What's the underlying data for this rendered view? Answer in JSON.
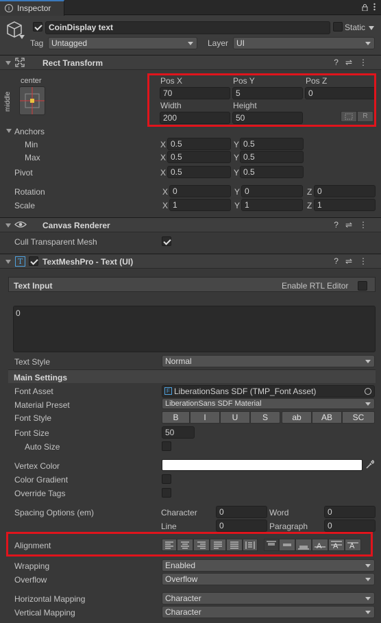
{
  "tab": {
    "title": "Inspector"
  },
  "object": {
    "enabled": true,
    "name": "CoinDisplay text",
    "static_label": "Static",
    "tag_label": "Tag",
    "tag_value": "Untagged",
    "layer_label": "Layer",
    "layer_value": "UI"
  },
  "rect_transform": {
    "title": "Rect Transform",
    "anchor_h": "center",
    "anchor_v": "middle",
    "pos_x_label": "Pos X",
    "pos_y_label": "Pos Y",
    "pos_z_label": "Pos Z",
    "pos_x": "70",
    "pos_y": "5",
    "pos_z": "0",
    "width_label": "Width",
    "height_label": "Height",
    "width": "200",
    "height": "50",
    "r_button": "R",
    "anchors_label": "Anchors",
    "min_label": "Min",
    "max_label": "Max",
    "anchor_min_x": "0.5",
    "anchor_min_y": "0.5",
    "anchor_max_x": "0.5",
    "anchor_max_y": "0.5",
    "pivot_label": "Pivot",
    "pivot_x": "0.5",
    "pivot_y": "0.5",
    "rotation_label": "Rotation",
    "rot_x": "0",
    "rot_y": "0",
    "rot_z": "0",
    "scale_label": "Scale",
    "scale_x": "1",
    "scale_y": "1",
    "scale_z": "1",
    "x": "X",
    "y": "Y",
    "z": "Z"
  },
  "canvas_renderer": {
    "title": "Canvas Renderer",
    "cull_label": "Cull Transparent Mesh",
    "cull_value": true
  },
  "tmp": {
    "title": "TextMeshPro - Text (UI)",
    "text_input_label": "Text Input",
    "rtl_label": "Enable RTL Editor",
    "text_value": "0",
    "text_style_label": "Text Style",
    "text_style_value": "Normal",
    "main_settings_label": "Main Settings",
    "font_asset_label": "Font Asset",
    "font_asset_value": "LiberationSans SDF (TMP_Font Asset)",
    "material_preset_label": "Material Preset",
    "material_preset_value": "LiberationSans SDF Material",
    "font_style_label": "Font Style",
    "font_style_buttons": [
      "B",
      "I",
      "U",
      "S",
      "ab",
      "AB",
      "SC"
    ],
    "font_size_label": "Font Size",
    "font_size_value": "50",
    "auto_size_label": "Auto Size",
    "vertex_color_label": "Vertex Color",
    "vertex_color": "#ffffff",
    "color_gradient_label": "Color Gradient",
    "override_tags_label": "Override Tags",
    "spacing_label": "Spacing Options (em)",
    "character_label": "Character",
    "character_value": "0",
    "word_label": "Word",
    "word_value": "0",
    "line_label": "Line",
    "line_value": "0",
    "paragraph_label": "Paragraph",
    "paragraph_value": "0",
    "alignment_label": "Alignment",
    "wrapping_label": "Wrapping",
    "wrapping_value": "Enabled",
    "overflow_label": "Overflow",
    "overflow_value": "Overflow",
    "hmap_label": "Horizontal Mapping",
    "hmap_value": "Character",
    "vmap_label": "Vertical Mapping",
    "vmap_value": "Character"
  },
  "colors": {
    "highlight": "#e0141c",
    "panel": "#383838",
    "field": "#2a2a2a"
  }
}
